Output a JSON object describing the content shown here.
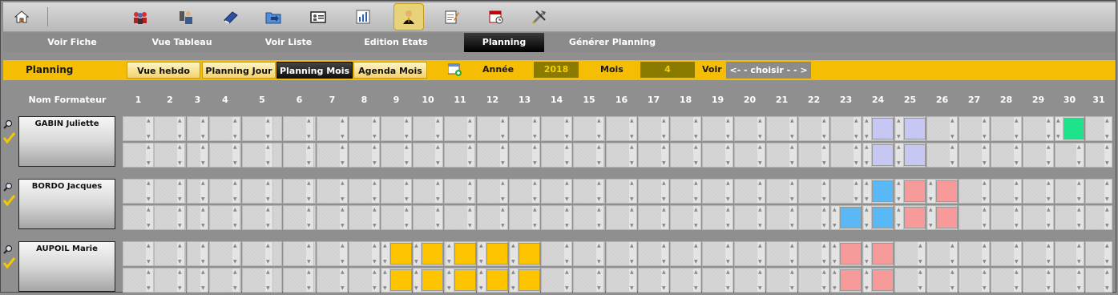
{
  "toolbar": {
    "icons": [
      "home-icon",
      "users-group-icon",
      "contact-phone-icon",
      "book-icon",
      "folder-arrow-icon",
      "id-card-icon",
      "bar-chart-icon",
      "trainer-person-icon",
      "edit-notepad-icon",
      "calendar-clock-icon",
      "tools-icon"
    ],
    "active_index": 7
  },
  "nav": {
    "items": [
      "Voir Fiche",
      "Vue Tableau",
      "Voir Liste",
      "Edition Etats",
      "Planning",
      "Générer Planning"
    ],
    "active_index": 4
  },
  "planning_bar": {
    "title": "Planning",
    "buttons": [
      "Vue hebdo",
      "Planning Jour",
      "Planning  Mois",
      "Agenda  Mois"
    ],
    "active_index": 2,
    "year_label": "Année",
    "year_value": "2018",
    "month_label": "Mois",
    "month_value": "4",
    "voir_label": "Voir",
    "choose_label": "<- - choisir - - >"
  },
  "grid": {
    "header_label": "Nom Formateur",
    "days": [
      "1",
      "2",
      "3",
      "4",
      "5",
      "6",
      "7",
      "8",
      "9",
      "10",
      "11",
      "12",
      "13",
      "14",
      "15",
      "16",
      "17",
      "18",
      "19",
      "20",
      "21",
      "22",
      "23",
      "24",
      "25",
      "26",
      "27",
      "28",
      "29",
      "30",
      "31"
    ],
    "people": [
      {
        "name": "GABIN Juliette",
        "rows": [
          {
            "24": "#c7c7f4",
            "25": "#c7c7f4",
            "30": "#1ee38a"
          },
          {
            "24": "#c7c7f4",
            "25": "#c7c7f4"
          }
        ]
      },
      {
        "name": "BORDO Jacques",
        "rows": [
          {
            "24": "#5ab8f5",
            "25": "#f79a9a",
            "26": "#f79a9a"
          },
          {
            "23": "#5ab8f5",
            "24": "#5ab8f5",
            "25": "#f79a9a",
            "26": "#f79a9a"
          }
        ]
      },
      {
        "name": "AUPOIL Marie",
        "rows": [
          {
            "9": "#ffc400",
            "10": "#ffc400",
            "11": "#ffc400",
            "12": "#ffc400",
            "13": "#ffc400",
            "23": "#f79a9a",
            "24": "#f79a9a"
          },
          {
            "9": "#ffc400",
            "10": "#ffc400",
            "11": "#ffc400",
            "12": "#ffc400",
            "13": "#ffc400",
            "23": "#f79a9a",
            "24": "#f79a9a"
          }
        ]
      }
    ]
  },
  "colors": {
    "accent_yellow": "#f5bd04",
    "active_dark": "#111111"
  }
}
